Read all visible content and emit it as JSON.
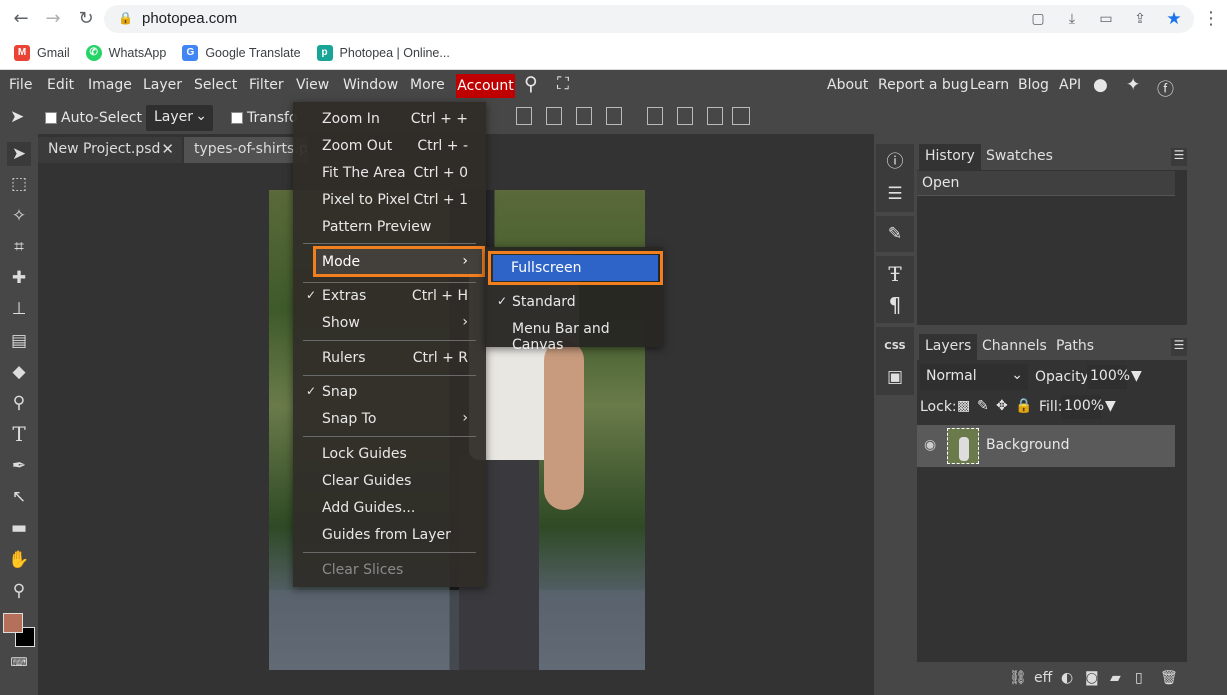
{
  "browser": {
    "url": "photopea.com",
    "bookmarks": [
      {
        "label": "Gmail",
        "icon": "gmail-icon",
        "color": "#ea4335"
      },
      {
        "label": "WhatsApp",
        "icon": "whatsapp-icon",
        "color": "#25d366"
      },
      {
        "label": "Google Translate",
        "icon": "translate-icon",
        "color": "#4285f4"
      },
      {
        "label": "Photopea | Online...",
        "icon": "photopea-icon",
        "color": "#18a497"
      }
    ]
  },
  "menubar": {
    "items": [
      "File",
      "Edit",
      "Image",
      "Layer",
      "Select",
      "Filter",
      "View",
      "Window",
      "More"
    ],
    "account": "Account",
    "right": [
      "About",
      "Report a bug",
      "Learn",
      "Blog",
      "API"
    ]
  },
  "options": {
    "auto_select": "Auto-Select",
    "layer_select": "Layer",
    "transform": "Transfo"
  },
  "tabs": [
    "New Project.psd",
    "types-of-shirts.ps"
  ],
  "view_menu": {
    "items": [
      {
        "label": "Zoom In",
        "shortcut": "Ctrl + +"
      },
      {
        "label": "Zoom Out",
        "shortcut": "Ctrl + -"
      },
      {
        "label": "Fit The Area",
        "shortcut": "Ctrl + 0"
      },
      {
        "label": "Pixel to Pixel",
        "shortcut": "Ctrl + 1"
      },
      {
        "label": "Pattern Preview",
        "shortcut": ""
      },
      {
        "label": "Mode",
        "shortcut": ""
      },
      {
        "label": "Extras",
        "shortcut": "Ctrl + H"
      },
      {
        "label": "Show",
        "shortcut": ""
      },
      {
        "label": "Rulers",
        "shortcut": "Ctrl + R"
      },
      {
        "label": "Snap",
        "shortcut": ""
      },
      {
        "label": "Snap To",
        "shortcut": ""
      },
      {
        "label": "Lock Guides",
        "shortcut": ""
      },
      {
        "label": "Clear Guides",
        "shortcut": ""
      },
      {
        "label": "Add Guides...",
        "shortcut": ""
      },
      {
        "label": "Guides from Layer",
        "shortcut": ""
      },
      {
        "label": "Clear Slices",
        "shortcut": ""
      }
    ]
  },
  "mode_submenu": {
    "items": [
      "Fullscreen",
      "Standard",
      "Menu Bar and Canvas"
    ]
  },
  "history_panel": {
    "tabs": [
      "History",
      "Swatches"
    ],
    "entries": [
      "Open"
    ]
  },
  "layers_panel": {
    "tabs": [
      "Layers",
      "Channels",
      "Paths"
    ],
    "blend_mode": "Normal",
    "opacity_label": "Opacity:",
    "opacity": "100%",
    "lock_label": "Lock:",
    "fill_label": "Fill:",
    "fill": "100%",
    "layers": [
      "Background"
    ]
  },
  "side_icons": {
    "css_label": "CSS"
  },
  "colors": {
    "accent_orange": "#f07f20",
    "highlight_blue": "#2e64c8",
    "account_red": "#c00000"
  }
}
